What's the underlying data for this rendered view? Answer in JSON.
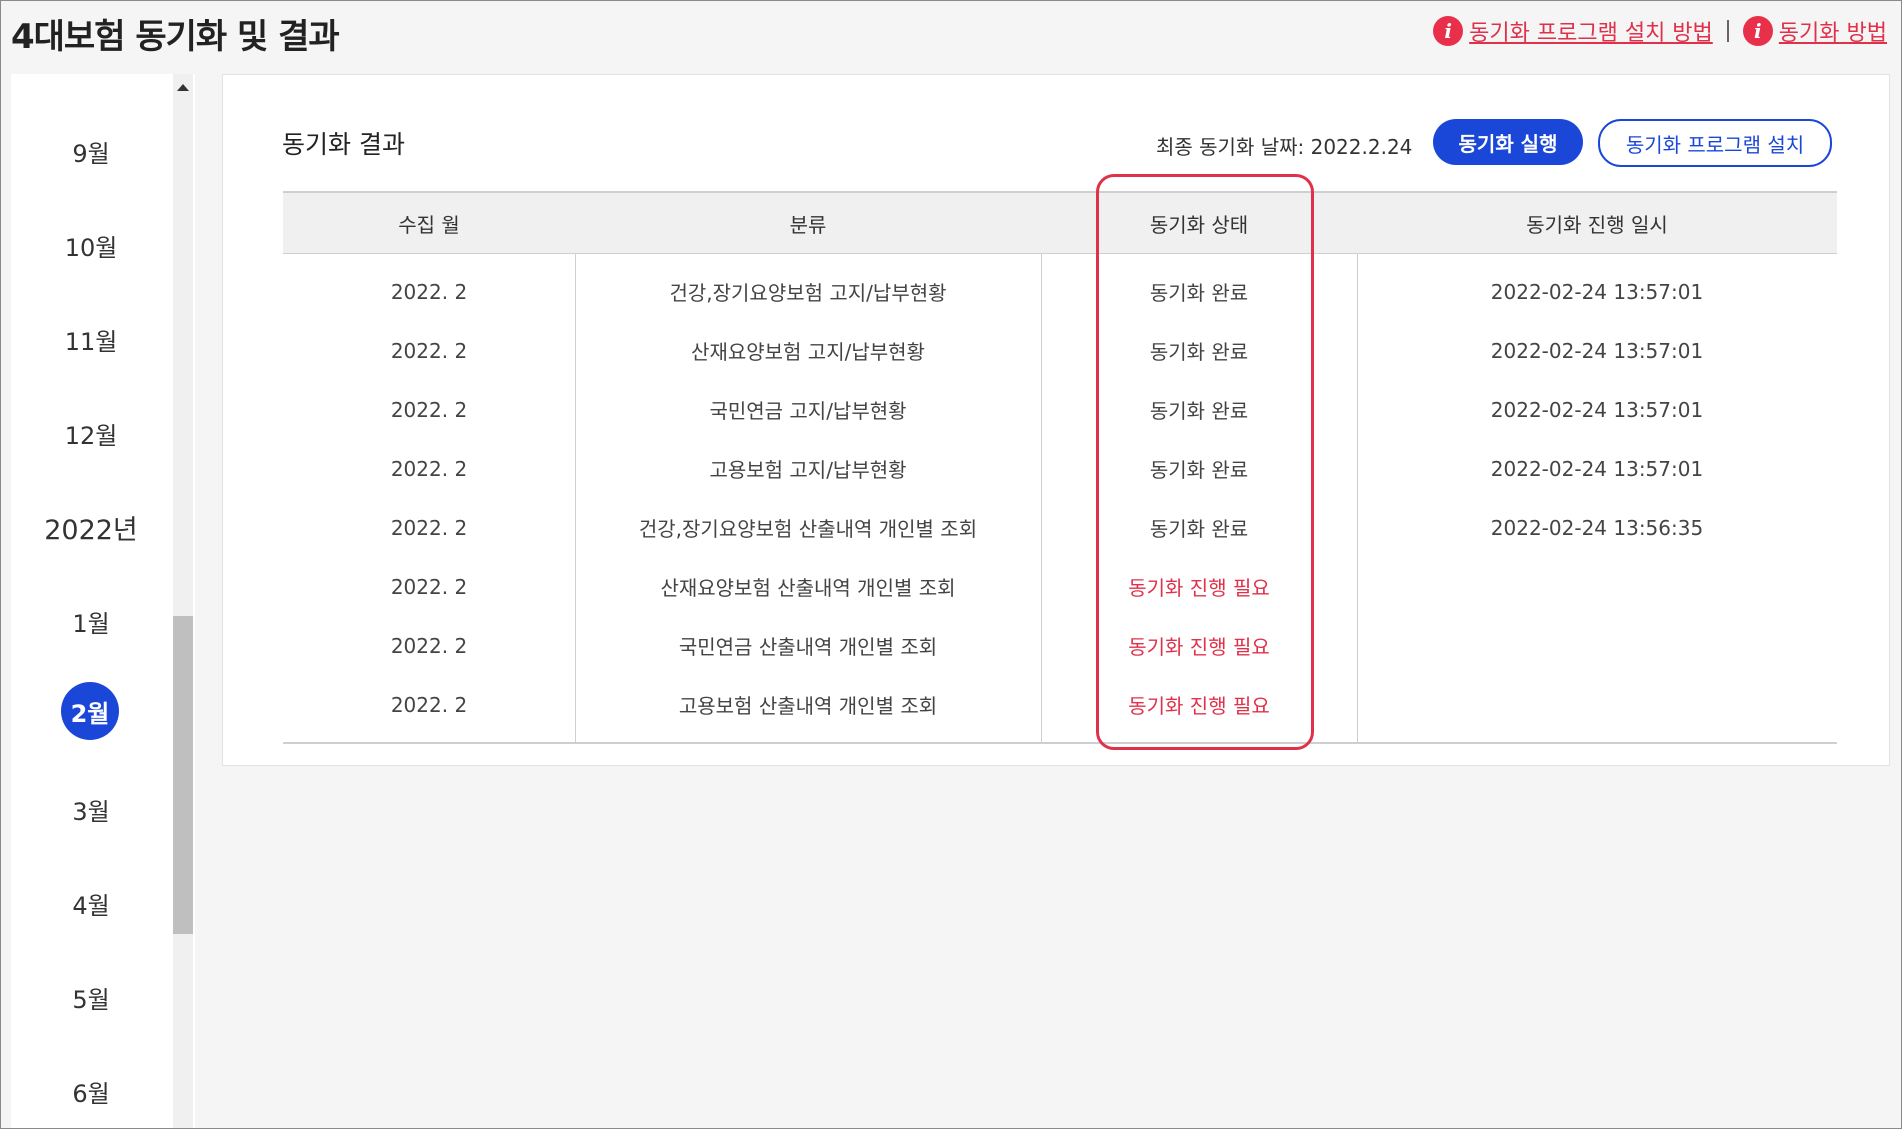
{
  "page_title": "4대보험 동기화 및 결과",
  "top_links": [
    {
      "label": "동기화 프로그램 설치 방법",
      "icon": "info-icon"
    },
    {
      "label": "동기화 방법",
      "icon": "info-icon"
    }
  ],
  "sidebar": {
    "months": [
      "9월",
      "10월",
      "11월",
      "12월",
      "2022년",
      "1월",
      "2월",
      "3월",
      "4월",
      "5월",
      "6월"
    ],
    "active": "2월"
  },
  "panel": {
    "title": "동기화 결과",
    "last_sync": "최종 동기화 날짜: 2022.2.24",
    "run_button": "동기화 실행",
    "install_button": "동기화 프로그램 설치"
  },
  "table": {
    "headers": [
      "수집 월",
      "분류",
      "동기화 상태",
      "동기화 진행 일시"
    ],
    "rows": [
      {
        "month": "2022. 2",
        "category": "건강,장기요양보험 고지/납부현황",
        "status": "동기화 완료",
        "datetime": "2022-02-24 13:57:01"
      },
      {
        "month": "2022. 2",
        "category": "산재요양보험 고지/납부현황",
        "status": "동기화 완료",
        "datetime": "2022-02-24 13:57:01"
      },
      {
        "month": "2022. 2",
        "category": "국민연금 고지/납부현황",
        "status": "동기화 완료",
        "datetime": "2022-02-24 13:57:01"
      },
      {
        "month": "2022. 2",
        "category": "고용보험 고지/납부현황",
        "status": "동기화 완료",
        "datetime": "2022-02-24 13:57:01"
      },
      {
        "month": "2022. 2",
        "category": "건강,장기요양보험 산출내역 개인별 조회",
        "status": "동기화 완료",
        "datetime": "2022-02-24 13:56:35"
      },
      {
        "month": "2022. 2",
        "category": "산재요양보험 산출내역 개인별 조회",
        "status": "동기화 진행 필요",
        "datetime": ""
      },
      {
        "month": "2022. 2",
        "category": "국민연금 산출내역 개인별 조회",
        "status": "동기화 진행 필요",
        "datetime": ""
      },
      {
        "month": "2022. 2",
        "category": "고용보험 산출내역 개인별 조회",
        "status": "동기화 진행 필요",
        "datetime": ""
      }
    ]
  },
  "colors": {
    "accent": "#1b47d8",
    "alert": "#e0314b"
  }
}
